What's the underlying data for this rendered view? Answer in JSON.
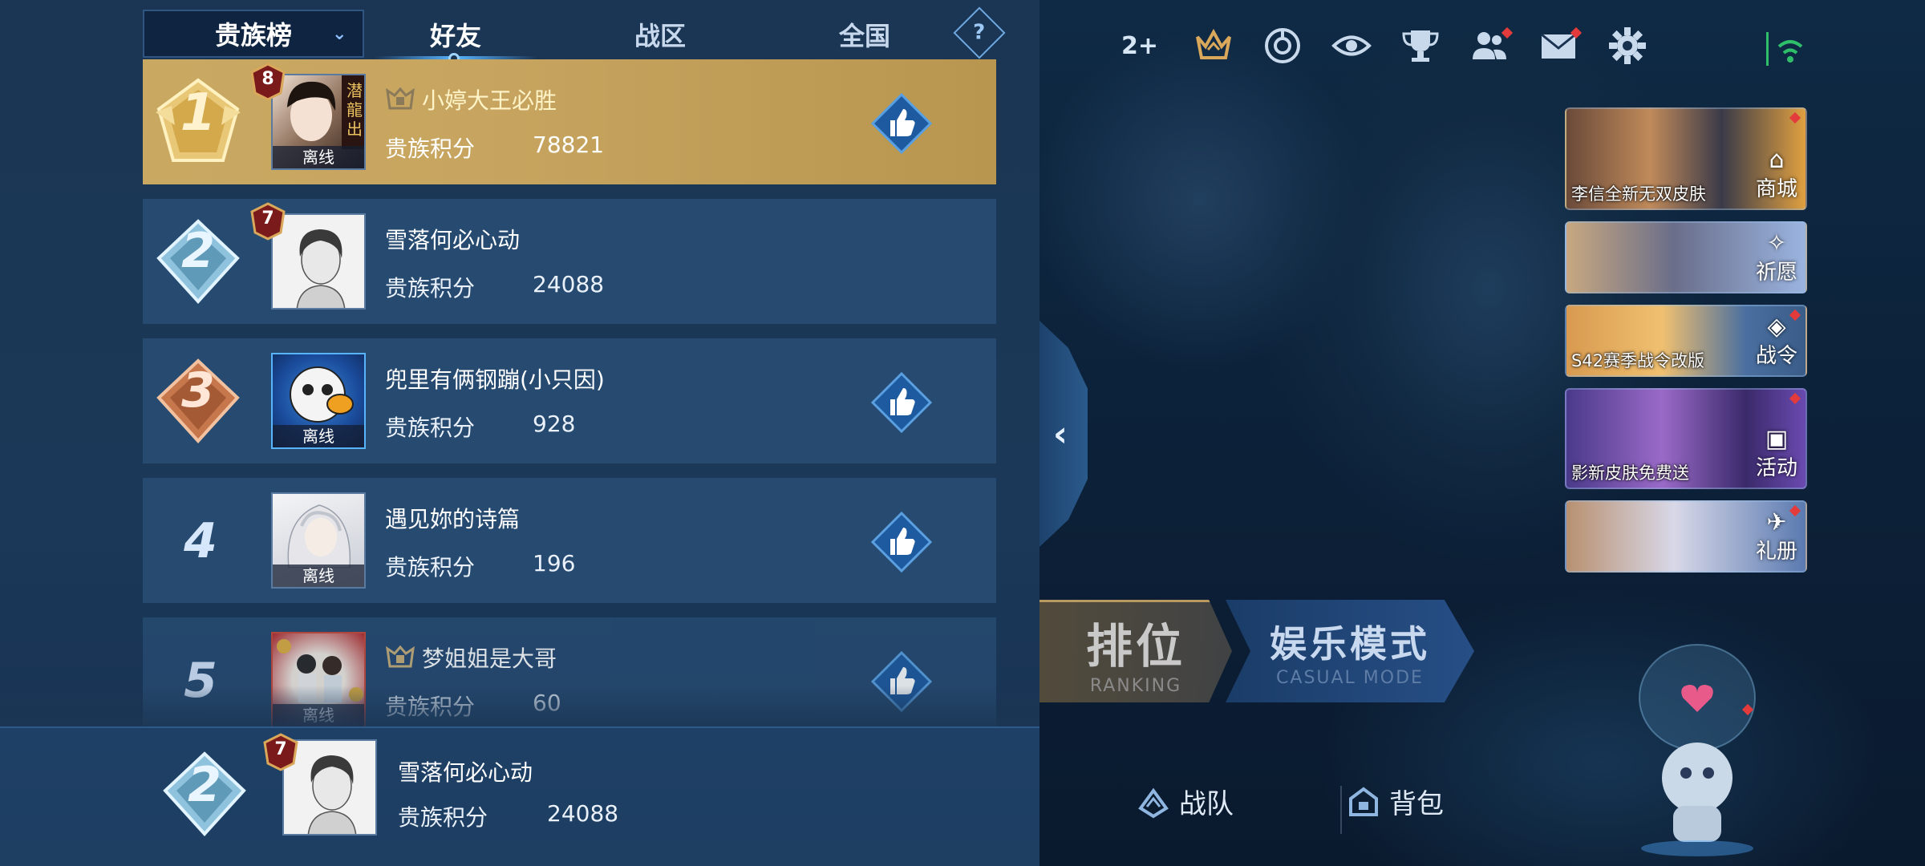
{
  "header": {
    "dropdown_label": "贵族榜",
    "tabs": [
      {
        "label": "好友",
        "active": true
      },
      {
        "label": "战区",
        "active": false
      },
      {
        "label": "全国",
        "active": false
      }
    ],
    "help_label": "?"
  },
  "leaderboard": {
    "score_label": "贵族积分",
    "rows": [
      {
        "rank": "1",
        "level": "8",
        "name": "小婷大王必胜",
        "score": "78821",
        "status": "离线",
        "has_crest": true,
        "has_like": true
      },
      {
        "rank": "2",
        "level": "7",
        "name": "雪落何必心动",
        "score": "24088",
        "status": "",
        "has_crest": false,
        "has_like": false
      },
      {
        "rank": "3",
        "level": "",
        "name": "兜里有俩钢蹦(小只因)",
        "score": "928",
        "status": "离线",
        "has_crest": false,
        "has_like": true
      },
      {
        "rank": "4",
        "level": "",
        "name": "遇见妳的诗篇",
        "score": "196",
        "status": "离线",
        "has_crest": false,
        "has_like": true
      },
      {
        "rank": "5",
        "level": "",
        "name": "梦姐姐是大哥",
        "score": "60",
        "status": "离线",
        "has_crest": true,
        "has_like": true
      }
    ],
    "me": {
      "rank": "2",
      "level": "7",
      "name": "雪落何必心动",
      "score": "24088"
    }
  },
  "top_bar": {
    "plus_count": "2+",
    "icons": [
      "crown-icon",
      "target-icon",
      "eye-icon",
      "trophy-icon",
      "friends-icon",
      "mail-icon",
      "gear-icon"
    ]
  },
  "banners": [
    {
      "caption": "李信全新无双皮肤",
      "action": "商城"
    },
    {
      "caption": "",
      "action": "祈愿"
    },
    {
      "caption": "S42赛季战令改版",
      "action": "战令"
    },
    {
      "caption": "影新皮肤免费送",
      "action": "活动"
    },
    {
      "caption": "",
      "action": "礼册"
    }
  ],
  "modes": {
    "ranking": {
      "label": "排位",
      "sub": "RANKING"
    },
    "casual": {
      "label": "娱乐模式",
      "sub": "CASUAL MODE"
    }
  },
  "bottom_nav": [
    {
      "label": "战队"
    },
    {
      "label": "背包"
    }
  ],
  "colors": {
    "panel_bg": "#1b3654",
    "row_bg": "#264a70",
    "first_row_gold": "#c9a862",
    "accent_blue": "#58b4ff"
  }
}
